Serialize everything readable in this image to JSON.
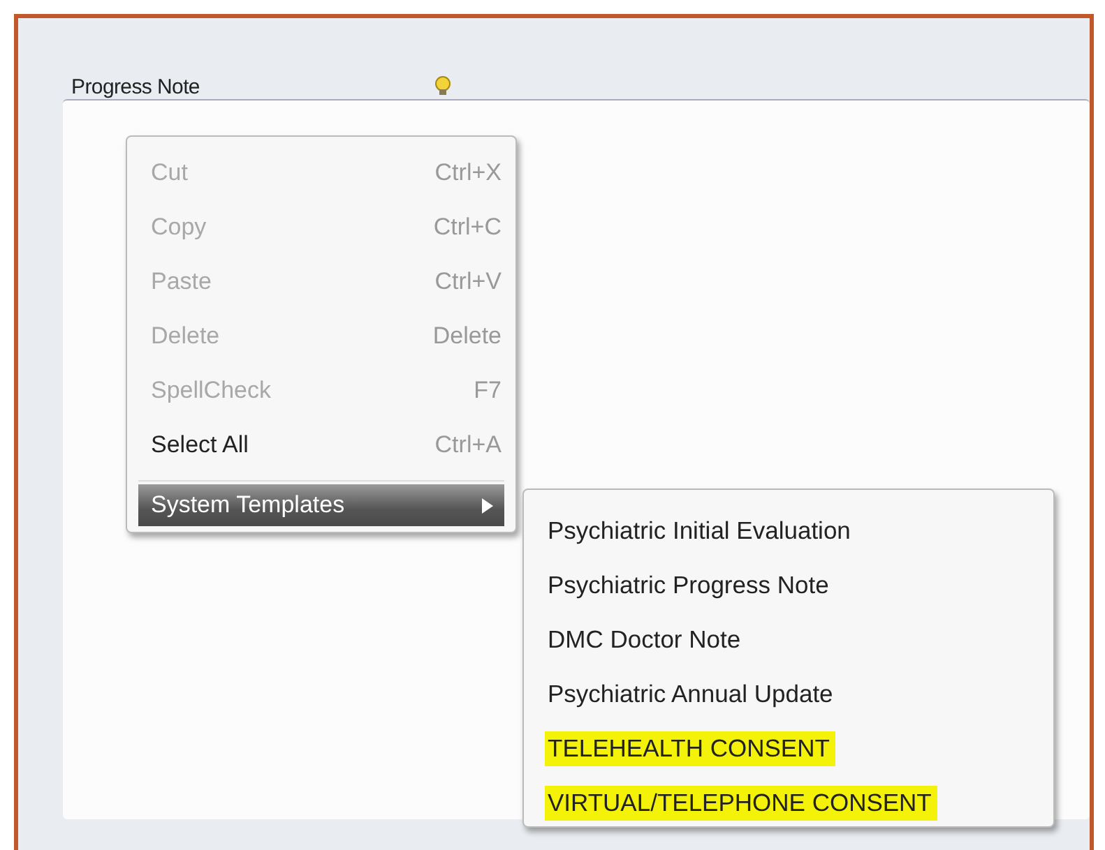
{
  "field": {
    "label": "Progress Note"
  },
  "context_menu": {
    "items": [
      {
        "kind": "command",
        "label": "Cut",
        "shortcut": "Ctrl+X",
        "disabled": true
      },
      {
        "kind": "command",
        "label": "Copy",
        "shortcut": "Ctrl+C",
        "disabled": true
      },
      {
        "kind": "command",
        "label": "Paste",
        "shortcut": "Ctrl+V",
        "disabled": true
      },
      {
        "kind": "command",
        "label": "Delete",
        "shortcut": "Delete",
        "disabled": true
      },
      {
        "kind": "command",
        "label": "SpellCheck",
        "shortcut": "F7",
        "disabled": true
      },
      {
        "kind": "command",
        "label": "Select All",
        "shortcut": "Ctrl+A",
        "disabled": false
      },
      {
        "kind": "separator"
      },
      {
        "kind": "submenu",
        "label": "System Templates",
        "selected": true
      }
    ]
  },
  "submenu": {
    "items": [
      {
        "label": "Psychiatric Initial Evaluation",
        "highlighted": false
      },
      {
        "label": "Psychiatric Progress Note",
        "highlighted": false
      },
      {
        "label": "DMC Doctor Note",
        "highlighted": false
      },
      {
        "label": "Psychiatric Annual Update",
        "highlighted": false
      },
      {
        "label": "TELEHEALTH CONSENT",
        "highlighted": true
      },
      {
        "label": "VIRTUAL/TELEPHONE CONSENT",
        "highlighted": true
      }
    ]
  }
}
